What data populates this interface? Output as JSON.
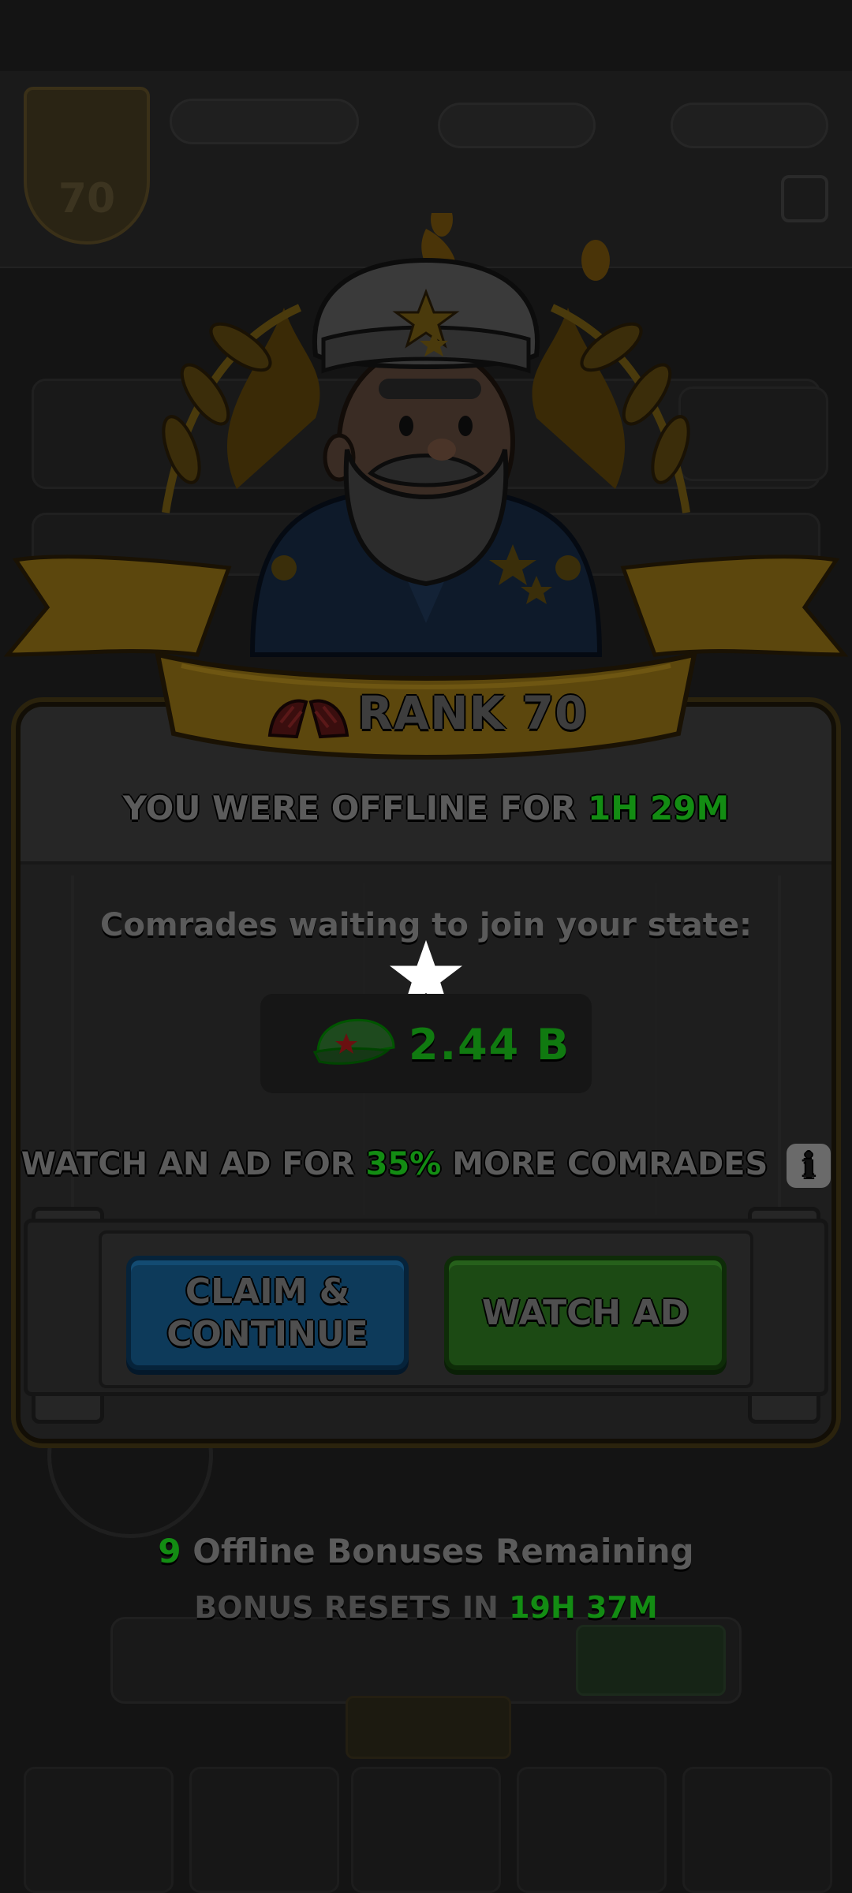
{
  "rank": {
    "label": "RANK 70"
  },
  "offline": {
    "prefix": "YOU WERE OFFLINE FOR",
    "hours": "1H",
    "minutes": "29M"
  },
  "comrades": {
    "label": "Comrades waiting to join your state:",
    "amount": "2.44 B"
  },
  "ad_offer": {
    "prefix": "WATCH AN AD FOR",
    "percent": "35%",
    "suffix": "MORE COMRADES"
  },
  "buttons": {
    "claim_label": "CLAIM & CONTINUE",
    "watch_label": "WATCH AD"
  },
  "bonuses": {
    "count": "9",
    "label": "Offline Bonuses Remaining"
  },
  "reset": {
    "prefix": "BONUS RESETS IN",
    "hours": "19H",
    "minutes": "37M"
  },
  "colors": {
    "accent_green": "#138c13",
    "claim_blue": "#0d3a5a",
    "watch_green": "#1c4a14",
    "ribbon_gold": "#7a5d0e"
  }
}
